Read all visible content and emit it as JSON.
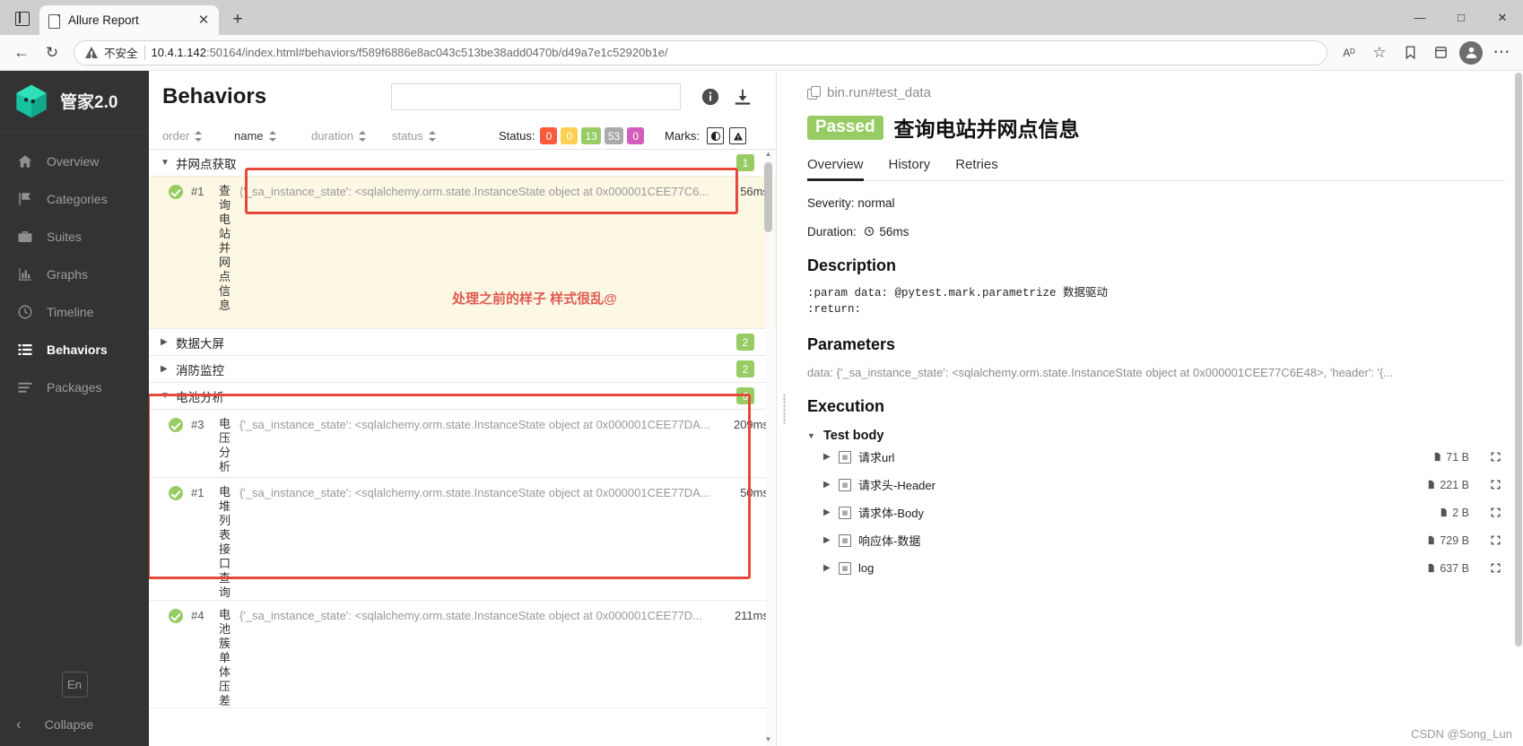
{
  "browser": {
    "tab": {
      "title": "Allure Report",
      "close_label": "✕"
    },
    "new_tab_label": "+",
    "window": {
      "minimize": "—",
      "maximize": "□",
      "close": "✕"
    },
    "back_label": "←",
    "reload_label": "↻",
    "security_label": "不安全",
    "url_host": "10.4.1.142",
    "url_rest": ":50164/index.html#behaviors/f589f6886e8ac043c513be38add0470b/d49a7e1c52920b1e/",
    "read_aloud_label": "Aᴰ",
    "favorite_label": "☆",
    "collections_label": "✥",
    "settings_label": "⋯"
  },
  "sidebar": {
    "brand": "管家2.0",
    "items": [
      {
        "label": "Overview",
        "icon": "home-icon",
        "active": false
      },
      {
        "label": "Categories",
        "icon": "flag-icon",
        "active": false
      },
      {
        "label": "Suites",
        "icon": "briefcase-icon",
        "active": false
      },
      {
        "label": "Graphs",
        "icon": "bar-chart-icon",
        "active": false
      },
      {
        "label": "Timeline",
        "icon": "clock-icon",
        "active": false
      },
      {
        "label": "Behaviors",
        "icon": "list-icon",
        "active": true
      },
      {
        "label": "Packages",
        "icon": "lines-icon",
        "active": false
      }
    ],
    "language": "En",
    "collapse": "Collapse"
  },
  "left_pane": {
    "title": "Behaviors",
    "search_placeholder": "",
    "search_value": "",
    "info_icon": "info-icon",
    "download_icon": "download-icon",
    "columns": [
      {
        "label": "order"
      },
      {
        "label": "name"
      },
      {
        "label": "duration"
      },
      {
        "label": "status"
      }
    ],
    "status_label": "Status:",
    "status_badges": [
      {
        "value": "0",
        "color": "#fd5a3e"
      },
      {
        "value": "0",
        "color": "#ffd050"
      },
      {
        "value": "13",
        "color": "#97cc64"
      },
      {
        "value": "53",
        "color": "#aaaaaa"
      },
      {
        "value": "0",
        "color": "#d35ebe"
      }
    ],
    "marks_label": "Marks:",
    "marks": [
      "flaky-icon",
      "broken-icon"
    ],
    "groups": [
      {
        "name": "并网点获取",
        "expanded": true,
        "count": "1",
        "count_color": "#97cc64",
        "tests": [
          {
            "order": "#1",
            "name": "查询电站并网点信息",
            "description": "{'_sa_instance_state': <sqlalchemy.orm.state.InstanceState object at 0x000001CEE77C6...",
            "duration": "56ms",
            "selected": true
          }
        ]
      },
      {
        "name": "数据大屏",
        "expanded": false,
        "count": "2",
        "count_color": "#97cc64",
        "tests": []
      },
      {
        "name": "消防监控",
        "expanded": false,
        "count": "2",
        "count_color": "#97cc64",
        "tests": []
      },
      {
        "name": "电池分析",
        "expanded": true,
        "count": "6",
        "count_color": "#97cc64",
        "tests": [
          {
            "order": "#3",
            "name": "电压分析",
            "description": "{'_sa_instance_state': <sqlalchemy.orm.state.InstanceState object at 0x000001CEE77DA...",
            "duration": "209ms",
            "selected": false
          },
          {
            "order": "#1",
            "name": "电堆列表接口查询",
            "description": "{'_sa_instance_state': <sqlalchemy.orm.state.InstanceState object at 0x000001CEE77DA...",
            "duration": "50ms",
            "selected": false
          },
          {
            "order": "#4",
            "name": "电池簇单体压差",
            "description": "{'_sa_instance_state': <sqlalchemy.orm.state.InstanceState object at 0x000001CEE77D...",
            "duration": "211ms",
            "selected": false
          }
        ]
      }
    ],
    "annotation": "处理之前的样子 样式很乱@"
  },
  "right_pane": {
    "breadcrumb": "bin.run#test_data",
    "status_badge": "Passed",
    "title": "查询电站并网点信息",
    "tabs": [
      {
        "label": "Overview",
        "active": true
      },
      {
        "label": "History",
        "active": false
      },
      {
        "label": "Retries",
        "active": false
      }
    ],
    "severity": "Severity: normal",
    "duration_label": "Duration:",
    "duration_value": "56ms",
    "description_heading": "Description",
    "description_body": ":param data: @pytest.mark.parametrize 数据驱动\n:return:",
    "parameters_heading": "Parameters",
    "parameters_value": "data: {'_sa_instance_state': <sqlalchemy.orm.state.InstanceState object at 0x000001CEE77C6E48>, 'header': '{...",
    "execution_heading": "Execution",
    "test_body_label": "Test body",
    "steps": [
      {
        "label": "请求url",
        "size": "71 B"
      },
      {
        "label": "请求头-Header",
        "size": "221 B"
      },
      {
        "label": "请求体-Body",
        "size": "2 B"
      },
      {
        "label": "响应体-数据",
        "size": "729 B"
      },
      {
        "label": "log",
        "size": "637 B"
      }
    ],
    "watermark": "CSDN @Song_Lun"
  }
}
